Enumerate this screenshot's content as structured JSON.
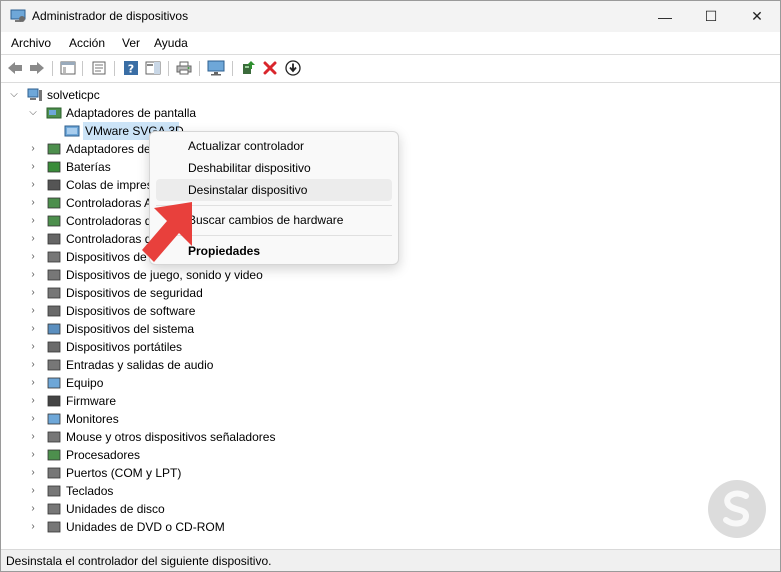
{
  "window": {
    "title": "Administrador de dispositivos",
    "minimize": "—",
    "maximize": "☐",
    "close": "✕"
  },
  "menu": [
    "Archivo",
    "Acción",
    "Ver",
    "Ayuda"
  ],
  "tree": {
    "root": "solveticpc",
    "expanded_category": "Adaptadores de pantalla",
    "selected_device": "VMware SVGA 3D",
    "categories": [
      "Adaptadores de red",
      "Baterías",
      "Colas de impresión",
      "Controladoras ATA/ATAPI IDE",
      "Controladoras de almacenamiento",
      "Controladoras de bus serie universal",
      "Dispositivos de interfaz de usuario (HID)",
      "Dispositivos de juego, sonido y video",
      "Dispositivos de seguridad",
      "Dispositivos de software",
      "Dispositivos del sistema",
      "Dispositivos portátiles",
      "Entradas y salidas de audio",
      "Equipo",
      "Firmware",
      "Monitores",
      "Mouse y otros dispositivos señaladores",
      "Procesadores",
      "Puertos (COM y LPT)",
      "Teclados",
      "Unidades de disco",
      "Unidades de DVD o CD-ROM"
    ],
    "visible_truncated": [
      "Adaptadores de",
      "Baterías",
      "Colas de impres",
      "Controladoras A",
      "Controladoras d",
      "Controladoras d",
      "Dispositivos de i"
    ]
  },
  "context_menu": {
    "items": [
      {
        "label": "Actualizar controlador",
        "bold": false
      },
      {
        "label": "Deshabilitar dispositivo",
        "bold": false
      },
      {
        "label": "Desinstalar dispositivo",
        "bold": false,
        "hover": true
      },
      {
        "label": "Buscar cambios de hardware",
        "bold": false
      },
      {
        "label": "Propiedades",
        "bold": true
      }
    ]
  },
  "status": {
    "text": "Desinstala el controlador del siguiente dispositivo."
  },
  "colors": {
    "selection": "#cce4f7",
    "arrow": "#e8403c",
    "delete_icon": "#d9262c",
    "toolbar_icon": "#3a6ea5"
  }
}
